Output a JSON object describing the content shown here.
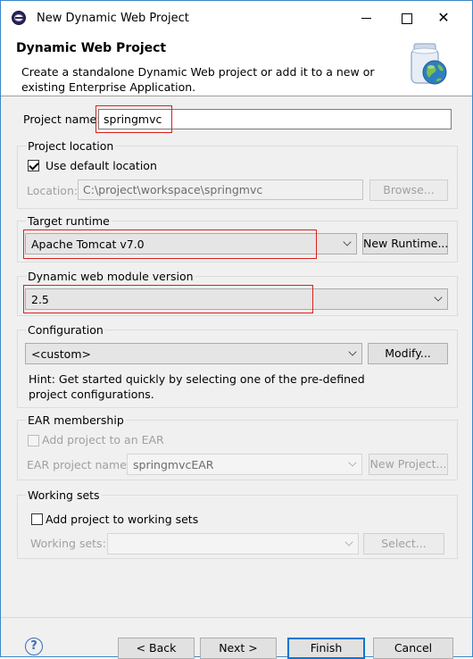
{
  "window": {
    "title": "New Dynamic Web Project"
  },
  "header": {
    "title": "Dynamic Web Project",
    "description": "Create a standalone Dynamic Web project or add it to a new or existing Enterprise Application."
  },
  "project_name": {
    "label": "Project name:",
    "value": "springmvc"
  },
  "project_location": {
    "group_title": "Project location",
    "use_default_label": "Use default location",
    "use_default_checked": true,
    "location_label": "Location:",
    "location_value": "C:\\project\\workspace\\springmvc",
    "browse_label": "Browse..."
  },
  "target_runtime": {
    "group_title": "Target runtime",
    "selected": "Apache Tomcat v7.0",
    "new_runtime_label": "New Runtime..."
  },
  "module_version": {
    "group_title": "Dynamic web module version",
    "selected": "2.5"
  },
  "configuration": {
    "group_title": "Configuration",
    "selected": "<custom>",
    "modify_label": "Modify...",
    "hint": "Hint: Get started quickly by selecting one of the pre-defined project configurations."
  },
  "ear": {
    "group_title": "EAR membership",
    "add_label": "Add project to an EAR",
    "add_checked": false,
    "project_name_label": "EAR project name:",
    "project_name_value": "springmvcEAR",
    "new_project_label": "New Project..."
  },
  "working_sets": {
    "group_title": "Working sets",
    "add_label": "Add project to working sets",
    "add_checked": false,
    "sets_label": "Working sets:",
    "sets_value": "",
    "select_label": "Select..."
  },
  "footer": {
    "help_glyph": "?",
    "back_label": "< Back",
    "next_label": "Next >",
    "finish_label": "Finish",
    "cancel_label": "Cancel"
  },
  "colors": {
    "highlight_box": "#d9211d",
    "focus_border": "#0078d7",
    "window_border": "#3a87c8"
  },
  "icons": {
    "app": "eclipse-icon",
    "header": "web-project-jar-globe-icon",
    "help": "help-icon"
  }
}
